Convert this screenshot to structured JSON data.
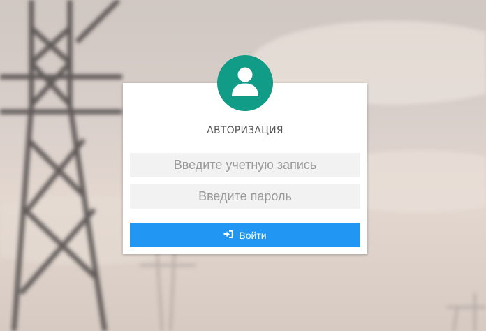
{
  "form": {
    "title": "АВТОРИЗАЦИЯ",
    "login_placeholder": "Введите учетную запись",
    "password_placeholder": "Введите пароль",
    "submit_label": "Войти"
  },
  "icons": {
    "avatar": "user-icon",
    "submit": "sign-in-icon"
  },
  "colors": {
    "avatar_bg": "#109c86",
    "button_bg": "#2196f3",
    "field_bg": "#f2f2f2"
  }
}
